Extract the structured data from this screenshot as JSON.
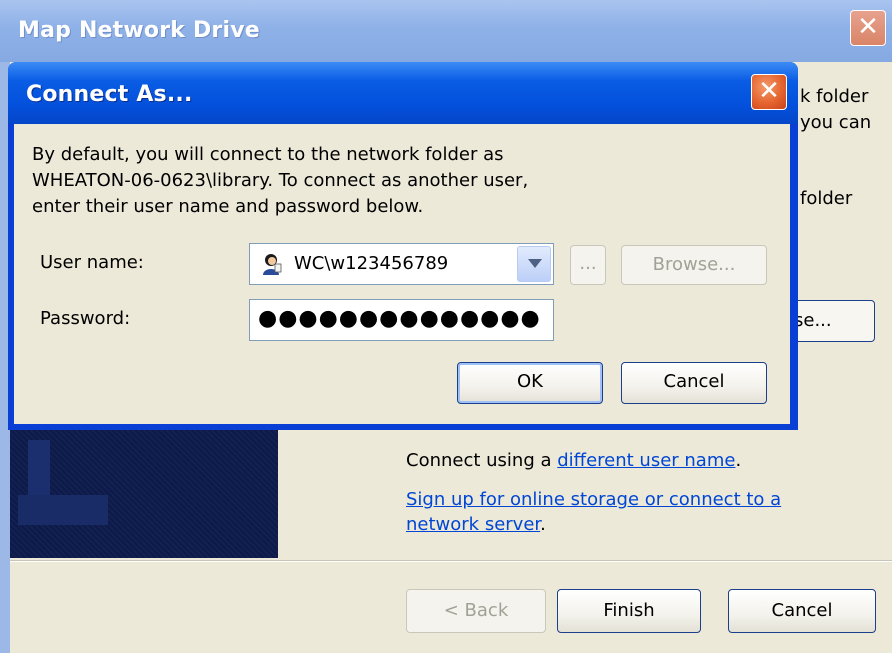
{
  "outer": {
    "title": "Map Network Drive",
    "close_glyph": "✕",
    "snippets": {
      "line1": "k folder",
      "line2": "you can",
      "line3": "folder"
    },
    "browse_partial": "se...",
    "connect_using_prefix": "Connect using a ",
    "connect_using_link": "different user name",
    "connect_using_suffix": ".",
    "signup_link_line1": "Sign up for online storage or connect to a",
    "signup_link_line2": "network server",
    "signup_suffix": ".",
    "back_label": "< Back",
    "finish_label": "Finish",
    "cancel_label": "Cancel"
  },
  "connect_as": {
    "title": "Connect As...",
    "close_glyph": "✕",
    "description_line1": "By default, you will connect to the network folder as",
    "description_line2": "WHEATON-06-0623\\library. To connect as another user,",
    "description_line3": "enter their user name and password below.",
    "username_label": "User name:",
    "username_value": "WC\\w123456789",
    "ellipsis_label": "...",
    "browse_label": "Browse...",
    "password_label": "Password:",
    "password_value": "●●●●●●●●●●●●●●",
    "ok_label": "OK",
    "cancel_label": "Cancel"
  },
  "colors": {
    "face": "#ECE9D8",
    "inner_title": "#0350DC",
    "link": "#0046D5",
    "close_red": "#E5642F"
  }
}
